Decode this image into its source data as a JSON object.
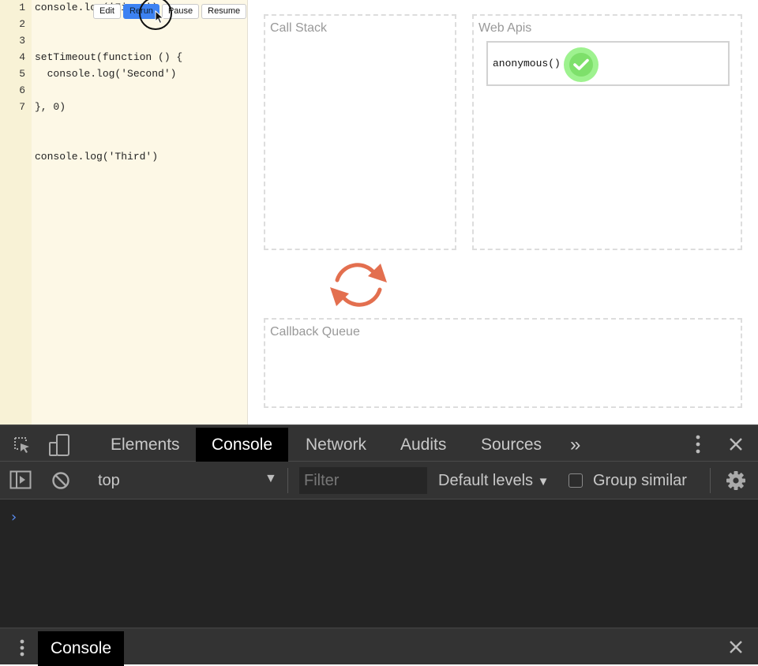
{
  "editor": {
    "line_numbers": [
      "1",
      "2",
      "3",
      "4",
      "5",
      "6",
      "7"
    ],
    "lines": [
      "console.log('First')",
      "setTimeout(function () {",
      "  console.log('Second')",
      "}, 0)",
      "console.log('Third')"
    ],
    "toolbar": {
      "edit": "Edit",
      "rerun": "Rerun",
      "pause": "Pause",
      "resume": "Resume"
    }
  },
  "visualizer": {
    "call_stack": {
      "title": "Call Stack"
    },
    "web_apis": {
      "title": "Web Apis",
      "task": "anonymous()"
    },
    "callback_queue": {
      "title": "Callback Queue"
    },
    "colors": {
      "loop_arrow": "#e36f4f",
      "check_green": "#7ee06b"
    }
  },
  "devtools": {
    "tabs": [
      "Elements",
      "Console",
      "Network",
      "Audits",
      "Sources"
    ],
    "selected_tab": "Console",
    "more_tabs": "»",
    "context": "top",
    "filter_placeholder": "Filter",
    "levels": "Default levels",
    "group_similar": "Group similar",
    "prompt": "›",
    "drawer_tab": "Console"
  }
}
